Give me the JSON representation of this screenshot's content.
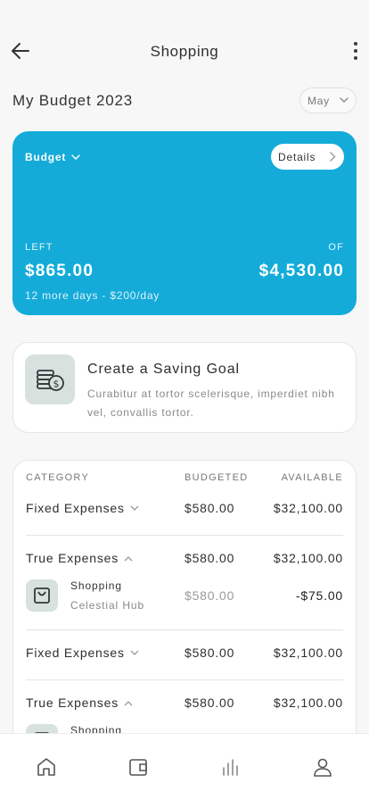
{
  "header": {
    "title": "Shopping",
    "back_icon": "arrow-left-icon",
    "more_icon": "more-vertical-icon"
  },
  "budget_header": {
    "title": "My Budget 2023",
    "month_selected": "May"
  },
  "budget_card": {
    "label": "Budget",
    "details_label": "Details",
    "left_label": "LEFT",
    "left_value": "$865.00",
    "of_label": "OF",
    "of_value": "$4,530.00",
    "subtitle": "12 more days - $200/day",
    "color": "#14abd9"
  },
  "saving_goal": {
    "title": "Create a Saving Goal",
    "description": "Curabitur at tortor scelerisque, imperdiet nibh vel, convallis tortor.",
    "icon": "coins-icon"
  },
  "table": {
    "headers": [
      "CATEGORY",
      "BUDGETED",
      "AVAILABLE"
    ],
    "rows": [
      {
        "category": "Fixed Expenses",
        "budgeted": "$580.00",
        "available": "$32,100.00",
        "expanded": false
      },
      {
        "category": "True Expenses",
        "budgeted": "$580.00",
        "available": "$32,100.00",
        "expanded": true
      },
      {
        "category": "Fixed Expenses",
        "budgeted": "$580.00",
        "available": "$32,100.00",
        "expanded": false
      },
      {
        "category": "True Expenses",
        "budgeted": "$580.00",
        "available": "$32,100.00",
        "expanded": true
      }
    ],
    "sub_items": [
      {
        "name": "Shopping",
        "store": "Celestial Hub",
        "budgeted": "$580.00",
        "available": "-$75.00"
      },
      {
        "name": "Shopping",
        "store": "",
        "budgeted": "",
        "available": ""
      }
    ]
  },
  "tabbar": {
    "tabs": [
      "home-icon",
      "wallet-icon",
      "stats-icon",
      "profile-icon"
    ]
  }
}
